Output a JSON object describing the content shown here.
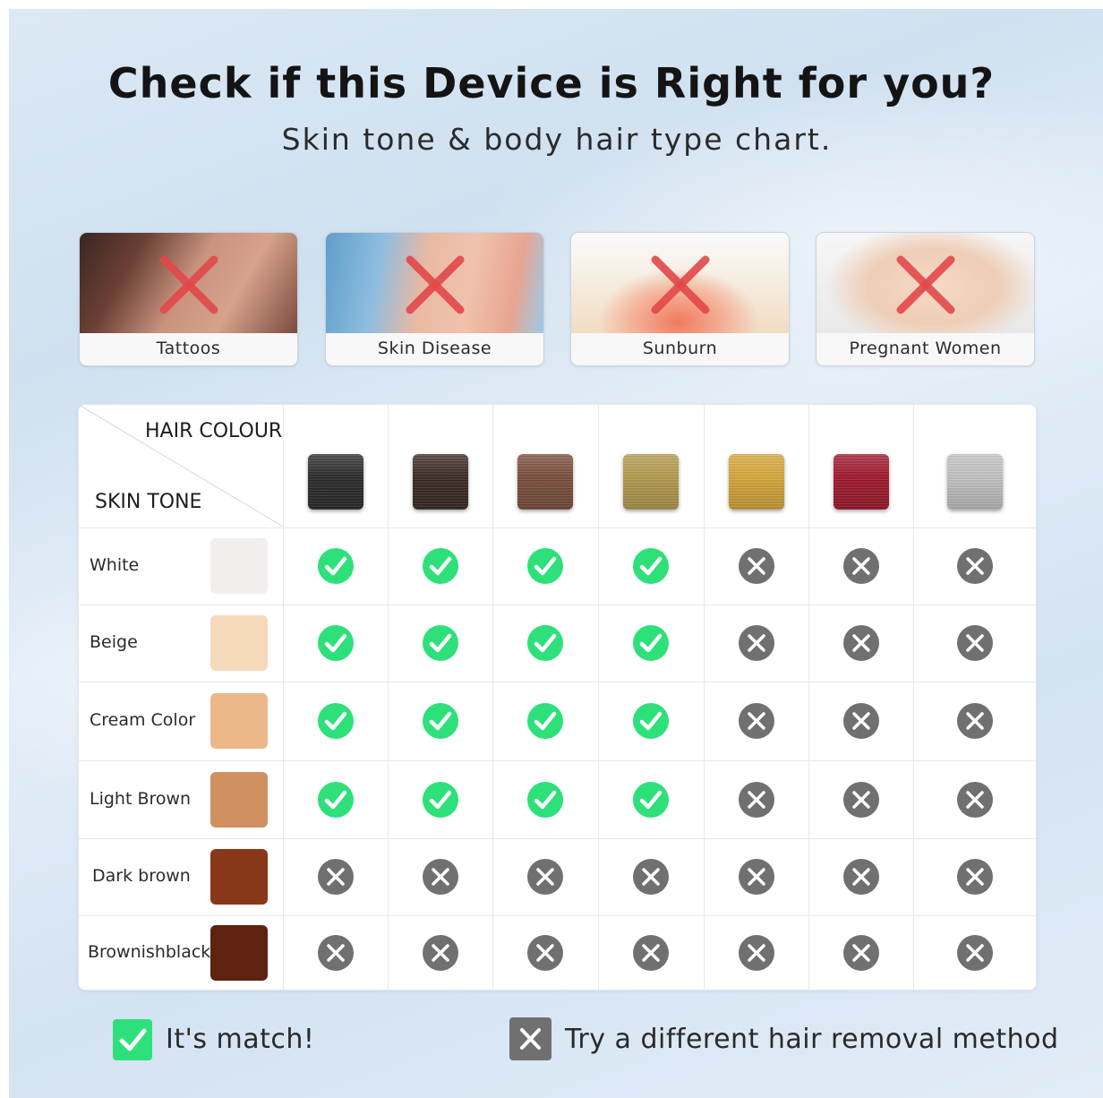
{
  "header": {
    "title": "Check if this Device is Right for you?",
    "subtitle": "Skin tone & body hair type chart."
  },
  "contraindications": [
    {
      "label": "Tattoos",
      "icon": "cross-icon"
    },
    {
      "label": "Skin Disease",
      "icon": "cross-icon"
    },
    {
      "label": "Sunburn",
      "icon": "cross-icon"
    },
    {
      "label": "Pregnant Women",
      "icon": "cross-icon"
    }
  ],
  "table": {
    "hair_header": "HAIR COLOUR",
    "skin_header": "SKIN TONE",
    "hair_colors": [
      {
        "name": "black",
        "color": "#2a2a2a"
      },
      {
        "name": "dark-brown",
        "color": "#3a2a22"
      },
      {
        "name": "medium-brown",
        "color": "#7a4e3c"
      },
      {
        "name": "dark-blonde",
        "color": "#b39a4e"
      },
      {
        "name": "golden-blonde",
        "color": "#d6a73a"
      },
      {
        "name": "red",
        "color": "#a0182c"
      },
      {
        "name": "gray",
        "color": "#c2c2c2"
      }
    ],
    "rows": [
      {
        "label": "White",
        "swatch": "#f0efee",
        "suitable": [
          true,
          true,
          true,
          true,
          false,
          false,
          false
        ]
      },
      {
        "label": "Beige",
        "swatch": "#f4d9bb",
        "suitable": [
          true,
          true,
          true,
          true,
          false,
          false,
          false
        ]
      },
      {
        "label": "Cream Color",
        "swatch": "#ecb889",
        "suitable": [
          true,
          true,
          true,
          true,
          false,
          false,
          false
        ]
      },
      {
        "label": "Light Brown",
        "swatch": "#d09060",
        "suitable": [
          true,
          true,
          true,
          true,
          false,
          false,
          false
        ]
      },
      {
        "label": "Dark brown",
        "swatch": "#883818",
        "suitable": [
          false,
          false,
          false,
          false,
          false,
          false,
          false
        ]
      },
      {
        "label": "Brownishblack",
        "swatch": "#5e2210",
        "suitable": [
          false,
          false,
          false,
          false,
          false,
          false,
          false
        ]
      }
    ]
  },
  "legend": {
    "match_label": "It's match!",
    "no_match_label": "Try a different hair removal method",
    "match_color": "#2ee07a",
    "no_match_color": "#707070"
  }
}
